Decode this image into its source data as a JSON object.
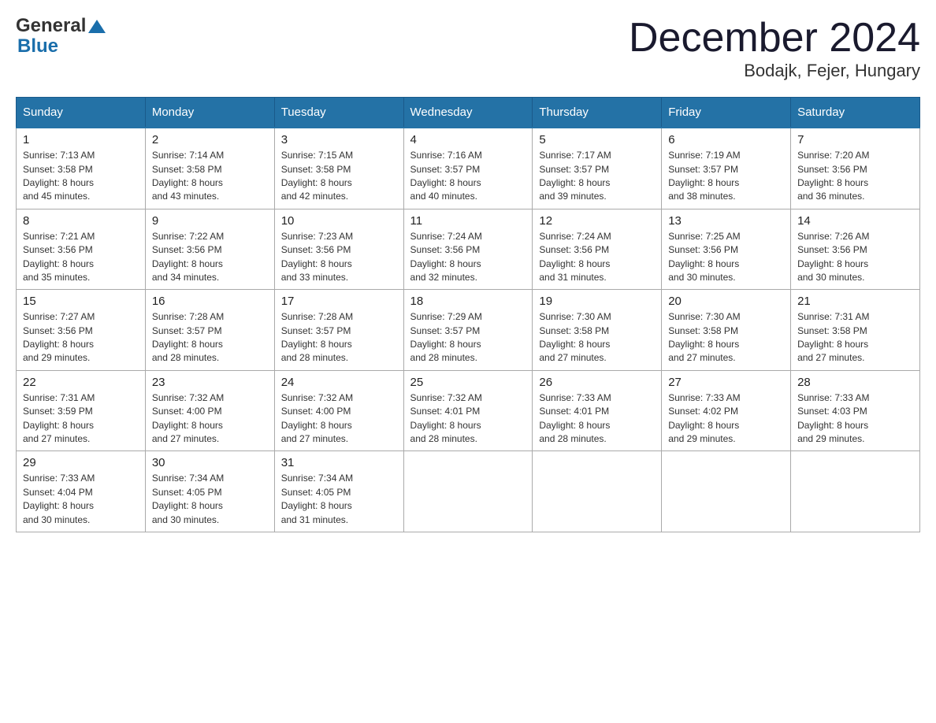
{
  "header": {
    "title": "December 2024",
    "location": "Bodajk, Fejer, Hungary",
    "logo_general": "General",
    "logo_blue": "Blue"
  },
  "days_of_week": [
    "Sunday",
    "Monday",
    "Tuesday",
    "Wednesday",
    "Thursday",
    "Friday",
    "Saturday"
  ],
  "weeks": [
    [
      {
        "day": "1",
        "sunrise": "7:13 AM",
        "sunset": "3:58 PM",
        "daylight": "8 hours and 45 minutes."
      },
      {
        "day": "2",
        "sunrise": "7:14 AM",
        "sunset": "3:58 PM",
        "daylight": "8 hours and 43 minutes."
      },
      {
        "day": "3",
        "sunrise": "7:15 AM",
        "sunset": "3:58 PM",
        "daylight": "8 hours and 42 minutes."
      },
      {
        "day": "4",
        "sunrise": "7:16 AM",
        "sunset": "3:57 PM",
        "daylight": "8 hours and 40 minutes."
      },
      {
        "day": "5",
        "sunrise": "7:17 AM",
        "sunset": "3:57 PM",
        "daylight": "8 hours and 39 minutes."
      },
      {
        "day": "6",
        "sunrise": "7:19 AM",
        "sunset": "3:57 PM",
        "daylight": "8 hours and 38 minutes."
      },
      {
        "day": "7",
        "sunrise": "7:20 AM",
        "sunset": "3:56 PM",
        "daylight": "8 hours and 36 minutes."
      }
    ],
    [
      {
        "day": "8",
        "sunrise": "7:21 AM",
        "sunset": "3:56 PM",
        "daylight": "8 hours and 35 minutes."
      },
      {
        "day": "9",
        "sunrise": "7:22 AM",
        "sunset": "3:56 PM",
        "daylight": "8 hours and 34 minutes."
      },
      {
        "day": "10",
        "sunrise": "7:23 AM",
        "sunset": "3:56 PM",
        "daylight": "8 hours and 33 minutes."
      },
      {
        "day": "11",
        "sunrise": "7:24 AM",
        "sunset": "3:56 PM",
        "daylight": "8 hours and 32 minutes."
      },
      {
        "day": "12",
        "sunrise": "7:24 AM",
        "sunset": "3:56 PM",
        "daylight": "8 hours and 31 minutes."
      },
      {
        "day": "13",
        "sunrise": "7:25 AM",
        "sunset": "3:56 PM",
        "daylight": "8 hours and 30 minutes."
      },
      {
        "day": "14",
        "sunrise": "7:26 AM",
        "sunset": "3:56 PM",
        "daylight": "8 hours and 30 minutes."
      }
    ],
    [
      {
        "day": "15",
        "sunrise": "7:27 AM",
        "sunset": "3:56 PM",
        "daylight": "8 hours and 29 minutes."
      },
      {
        "day": "16",
        "sunrise": "7:28 AM",
        "sunset": "3:57 PM",
        "daylight": "8 hours and 28 minutes."
      },
      {
        "day": "17",
        "sunrise": "7:28 AM",
        "sunset": "3:57 PM",
        "daylight": "8 hours and 28 minutes."
      },
      {
        "day": "18",
        "sunrise": "7:29 AM",
        "sunset": "3:57 PM",
        "daylight": "8 hours and 28 minutes."
      },
      {
        "day": "19",
        "sunrise": "7:30 AM",
        "sunset": "3:58 PM",
        "daylight": "8 hours and 27 minutes."
      },
      {
        "day": "20",
        "sunrise": "7:30 AM",
        "sunset": "3:58 PM",
        "daylight": "8 hours and 27 minutes."
      },
      {
        "day": "21",
        "sunrise": "7:31 AM",
        "sunset": "3:58 PM",
        "daylight": "8 hours and 27 minutes."
      }
    ],
    [
      {
        "day": "22",
        "sunrise": "7:31 AM",
        "sunset": "3:59 PM",
        "daylight": "8 hours and 27 minutes."
      },
      {
        "day": "23",
        "sunrise": "7:32 AM",
        "sunset": "4:00 PM",
        "daylight": "8 hours and 27 minutes."
      },
      {
        "day": "24",
        "sunrise": "7:32 AM",
        "sunset": "4:00 PM",
        "daylight": "8 hours and 27 minutes."
      },
      {
        "day": "25",
        "sunrise": "7:32 AM",
        "sunset": "4:01 PM",
        "daylight": "8 hours and 28 minutes."
      },
      {
        "day": "26",
        "sunrise": "7:33 AM",
        "sunset": "4:01 PM",
        "daylight": "8 hours and 28 minutes."
      },
      {
        "day": "27",
        "sunrise": "7:33 AM",
        "sunset": "4:02 PM",
        "daylight": "8 hours and 29 minutes."
      },
      {
        "day": "28",
        "sunrise": "7:33 AM",
        "sunset": "4:03 PM",
        "daylight": "8 hours and 29 minutes."
      }
    ],
    [
      {
        "day": "29",
        "sunrise": "7:33 AM",
        "sunset": "4:04 PM",
        "daylight": "8 hours and 30 minutes."
      },
      {
        "day": "30",
        "sunrise": "7:34 AM",
        "sunset": "4:05 PM",
        "daylight": "8 hours and 30 minutes."
      },
      {
        "day": "31",
        "sunrise": "7:34 AM",
        "sunset": "4:05 PM",
        "daylight": "8 hours and 31 minutes."
      },
      {
        "day": "",
        "sunrise": "",
        "sunset": "",
        "daylight": ""
      },
      {
        "day": "",
        "sunrise": "",
        "sunset": "",
        "daylight": ""
      },
      {
        "day": "",
        "sunrise": "",
        "sunset": "",
        "daylight": ""
      },
      {
        "day": "",
        "sunrise": "",
        "sunset": "",
        "daylight": ""
      }
    ]
  ],
  "labels": {
    "sunrise": "Sunrise:",
    "sunset": "Sunset:",
    "daylight": "Daylight:"
  }
}
